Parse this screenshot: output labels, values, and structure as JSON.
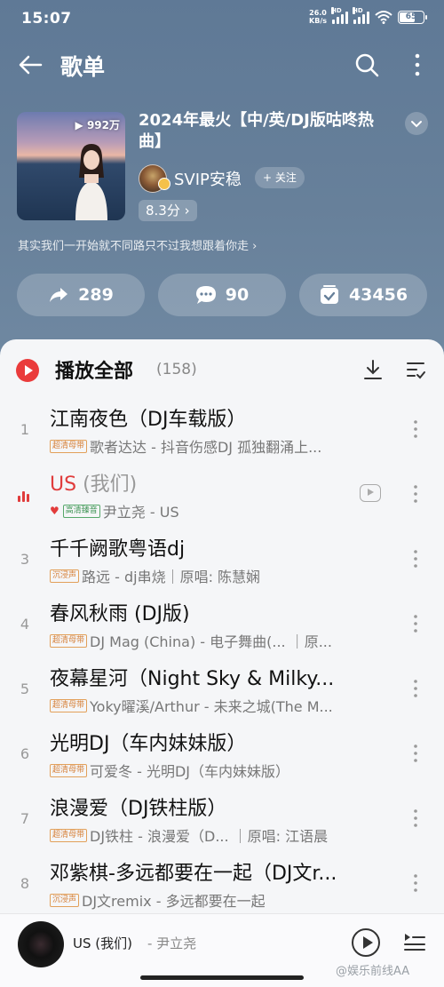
{
  "status_bar": {
    "time": "15:07",
    "net_speed_value": "26.0",
    "net_speed_unit": "KB/s",
    "signal_hd_1": "HD",
    "signal_hd_2": "HD",
    "battery": "65"
  },
  "topbar": {
    "title": "歌单",
    "back_icon": "back-arrow-icon",
    "search_icon": "search-icon",
    "more_icon": "more-vertical-icon"
  },
  "playlist": {
    "play_count": "992万",
    "title": "2024年最火【中/英/DJ版咕咚热曲】",
    "creator_name": "SVIP安稳",
    "follow_label": "关注",
    "rating": "8.3分",
    "description": "其实我们一开始就不同路只不过我想跟着你走"
  },
  "actions": {
    "share_count": "289",
    "comment_count": "90",
    "collect_count": "43456"
  },
  "song_list": {
    "play_all_label": "播放全部",
    "count": "(158)",
    "songs": [
      {
        "index": "1",
        "title": "江南夜色（DJ车载版）",
        "title_alt": "",
        "tag": "超清母带",
        "heart": "",
        "subtitle": "歌者达达 - 抖音伤感DJ 孤独翻涌上..."
      },
      {
        "index": "",
        "title": "US",
        "title_alt": " (我们)",
        "tag": "高清臻音",
        "heart": "♥",
        "subtitle": "尹立尧 - US"
      },
      {
        "index": "3",
        "title": "千千阙歌粤语dj",
        "title_alt": "",
        "tag": "沉浸声",
        "heart": "",
        "subtitle": "路远 - dj串烧｜原唱: 陈慧娴"
      },
      {
        "index": "4",
        "title": "春风秋雨 (DJ版)",
        "title_alt": "",
        "tag": "超清母带",
        "heart": "",
        "subtitle": "DJ Mag (China) - 电子舞曲(... ｜原..."
      },
      {
        "index": "5",
        "title": "夜幕星河（Night Sky & Milky...",
        "title_alt": "",
        "tag": "超清母带",
        "heart": "",
        "subtitle": "Yoky曜溪/Arthur - 未来之城(The M..."
      },
      {
        "index": "6",
        "title": "光明DJ（车内妹妹版）",
        "title_alt": "",
        "tag": "超清母带",
        "heart": "",
        "subtitle": "可爱冬 - 光明DJ（车内妹妹版）"
      },
      {
        "index": "7",
        "title": "浪漫爱（DJ铁柱版）",
        "title_alt": "",
        "tag": "超清母带",
        "heart": "",
        "subtitle": "DJ铁柱 - 浪漫爱（D... ｜原唱: 江语晨"
      },
      {
        "index": "8",
        "title": "邓紫棋-多远都要在一起（DJ文r...",
        "title_alt": "",
        "tag": "沉浸声",
        "heart": "",
        "subtitle": "DJ文remix - 多远都要在一起"
      }
    ]
  },
  "mini_player": {
    "title": "US (我们)",
    "artist": "- 尹立尧"
  },
  "watermark": "@娱乐前线AA",
  "colors": {
    "header_bg": "#67809a",
    "accent_red": "#e03c3c",
    "tag_orange": "#d6813a",
    "tag_green": "#3f9455"
  }
}
